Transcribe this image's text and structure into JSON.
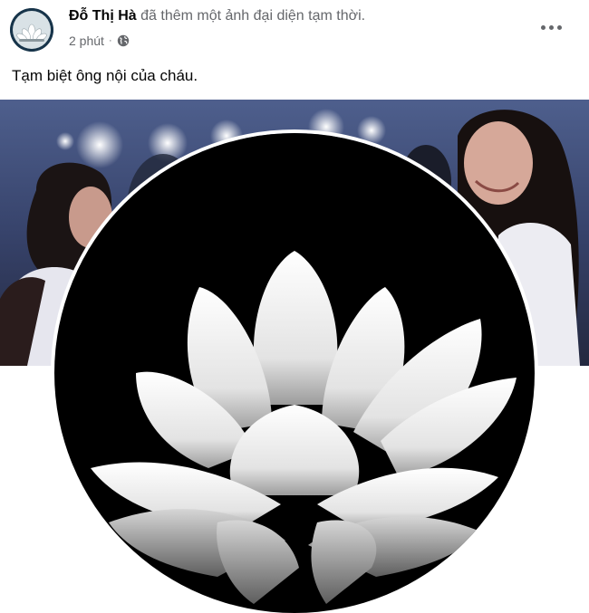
{
  "post": {
    "author_name": "Đỗ Thị Hà",
    "action_text": "đã thêm một ảnh đại diện tạm thời.",
    "timestamp": "2 phút",
    "separator": "·",
    "audience_icon": "globe-icon",
    "more_icon": "more-options-icon",
    "caption": "Tạm biệt ông nội của cháu."
  },
  "colors": {
    "name": "#050505",
    "secondary_text": "#65676b",
    "photo_background": "#000000"
  }
}
